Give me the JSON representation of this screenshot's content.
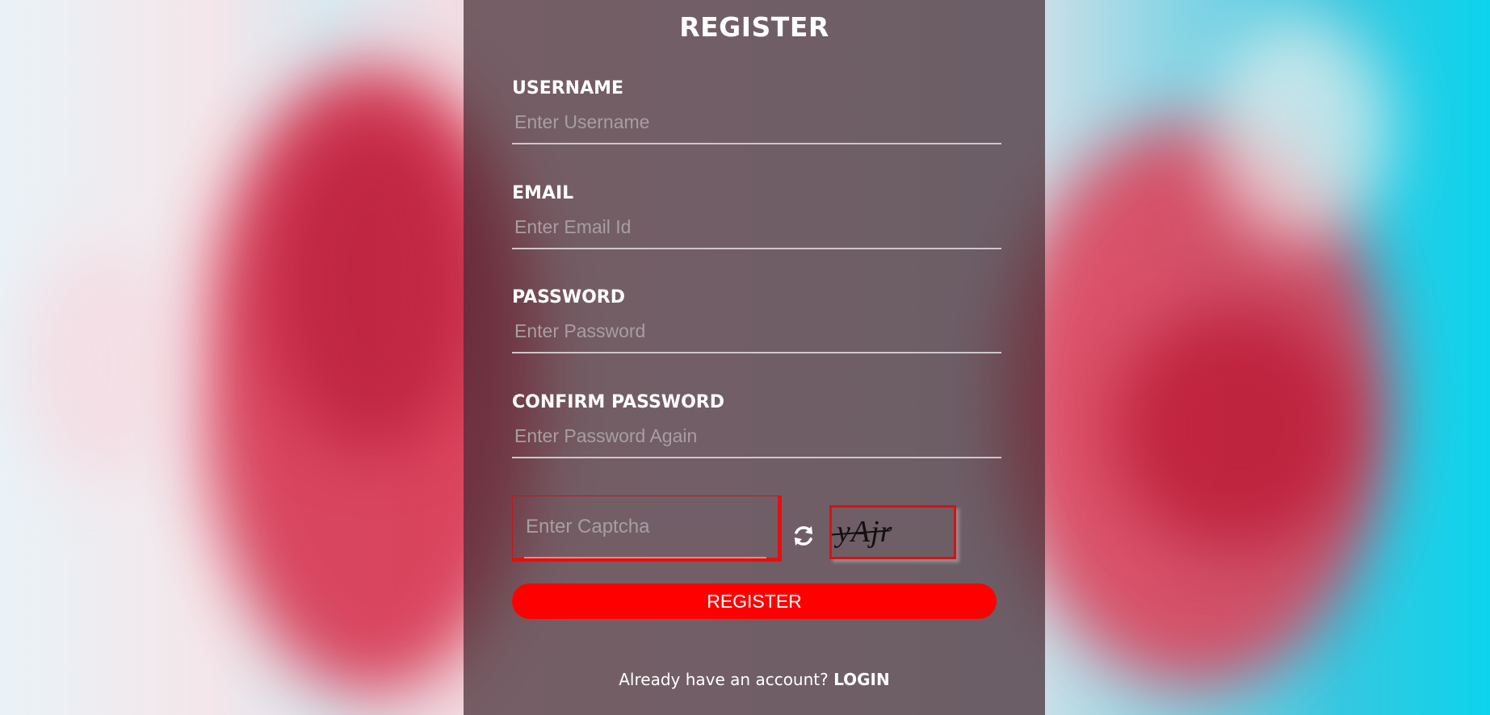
{
  "form": {
    "title": "REGISTER",
    "fields": [
      {
        "label": "USERNAME",
        "placeholder": "Enter Username"
      },
      {
        "label": "EMAIL",
        "placeholder": "Enter Email Id"
      },
      {
        "label": "PASSWORD",
        "placeholder": "Enter Password"
      },
      {
        "label": "CONFIRM PASSWORD",
        "placeholder": "Enter Password Again"
      }
    ],
    "captcha": {
      "placeholder": "Enter Captcha",
      "code": "yAjr",
      "refresh_icon": "refresh-icon"
    },
    "submit_label": "REGISTER",
    "footer": {
      "prompt": "Already have an account?",
      "link": "LOGIN"
    }
  },
  "colors": {
    "accent": "#ff0000",
    "card_overlay": "#462d34",
    "text": "#ffffff"
  }
}
